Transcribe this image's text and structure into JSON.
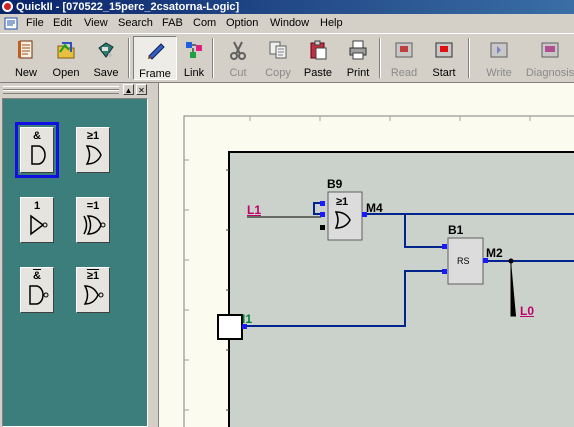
{
  "window": {
    "title": "QuickII - [070522_15perc_2csatorna-Logic]"
  },
  "menu": [
    "File",
    "Edit",
    "View",
    "Search",
    "FAB",
    "Com",
    "Option",
    "Window",
    "Help"
  ],
  "toolbar": {
    "new": "New",
    "open": "Open",
    "save": "Save",
    "frame": "Frame",
    "link": "Link",
    "cut": "Cut",
    "copy": "Copy",
    "paste": "Paste",
    "print": "Print",
    "read": "Read",
    "start": "Start",
    "write": "Write",
    "diagnosis": "Diagnosis"
  },
  "palette": {
    "and": "&",
    "or": "≥1",
    "not": "1",
    "xor": "=1",
    "nand": "&",
    "nor": "≥1"
  },
  "diagram": {
    "block_b9": "B9",
    "block_b9_symbol": "≥1",
    "block_b9_output": "M4",
    "block_b1": "B1",
    "block_b1_symbol": "RS",
    "block_b1_output": "M2",
    "input_l1": "L1",
    "output_l0": "L0",
    "input_i1": "I1"
  },
  "colors": {
    "wire": "#00238c",
    "sheet_bg": "#fbfbf0",
    "palette_bg": "#3c7e7c",
    "selected": "#1010e0",
    "signal_label": "#c0006c",
    "input_label": "#008040"
  }
}
